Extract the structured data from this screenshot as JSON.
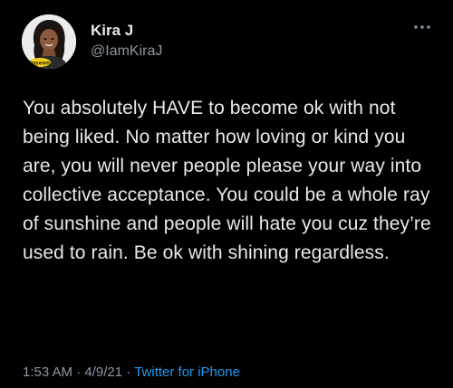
{
  "tweet": {
    "author": {
      "display_name": "Kira J",
      "handle": "@IamKiraJ"
    },
    "avatar": {
      "label": "Joseon"
    },
    "more_icon": "more-options-icon",
    "text": "You absolutely HAVE to become ok with not being liked. No matter how loving or kind you are, you will never people please your way into collective acceptance. You could be a whole ray of sunshine and people will hate you cuz they’re used to rain. Be ok with shining regardless.",
    "time": "1:53 AM",
    "separator": "·",
    "date": "4/9/21",
    "source": "Twitter for iPhone"
  },
  "colors": {
    "background": "#000000",
    "text_primary": "#e7e9ea",
    "text_secondary": "#8b98a5",
    "accent": "#1d9bf0"
  }
}
